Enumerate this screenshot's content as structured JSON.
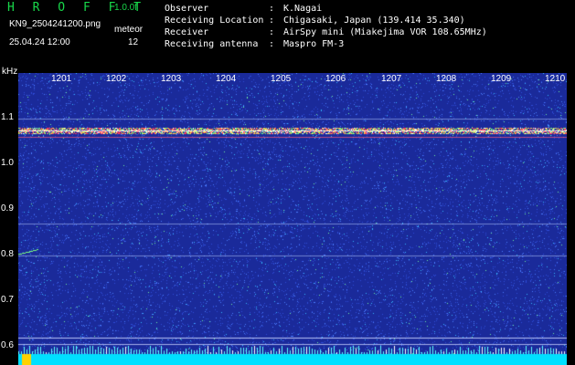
{
  "header": {
    "title": "H R O F F T",
    "version": "1.0.0f",
    "filename": "KN9_2504241200.png",
    "meteor_label": "meteor",
    "datetime": "25.04.24 12:00",
    "meteor_count": "12"
  },
  "info": {
    "rows": [
      {
        "key": "Observer",
        "value": "K.Nagai"
      },
      {
        "key": "Receiving Location",
        "value": "Chigasaki, Japan (139.414 35.340)"
      },
      {
        "key": "Receiver",
        "value": "AirSpy mini (Miakejima VOR 108.65MHz)"
      },
      {
        "key": "Receiving antenna",
        "value": "Maspro FM-3"
      }
    ]
  },
  "spectrogram": {
    "y_unit": "kHz",
    "x_ticks": [
      "1201",
      "1202",
      "1203",
      "1204",
      "1205",
      "1206",
      "1207",
      "1208",
      "1209",
      "1210"
    ],
    "y_ticks": [
      "1.1",
      "1.0",
      "0.9",
      "0.8",
      "0.7",
      "0.6"
    ],
    "colors": {
      "background": "#1a2a9a",
      "noise": "#3a6cff",
      "signal": "#ff4060",
      "floor": "#00e0ff",
      "marker": "#ffd200"
    }
  }
}
